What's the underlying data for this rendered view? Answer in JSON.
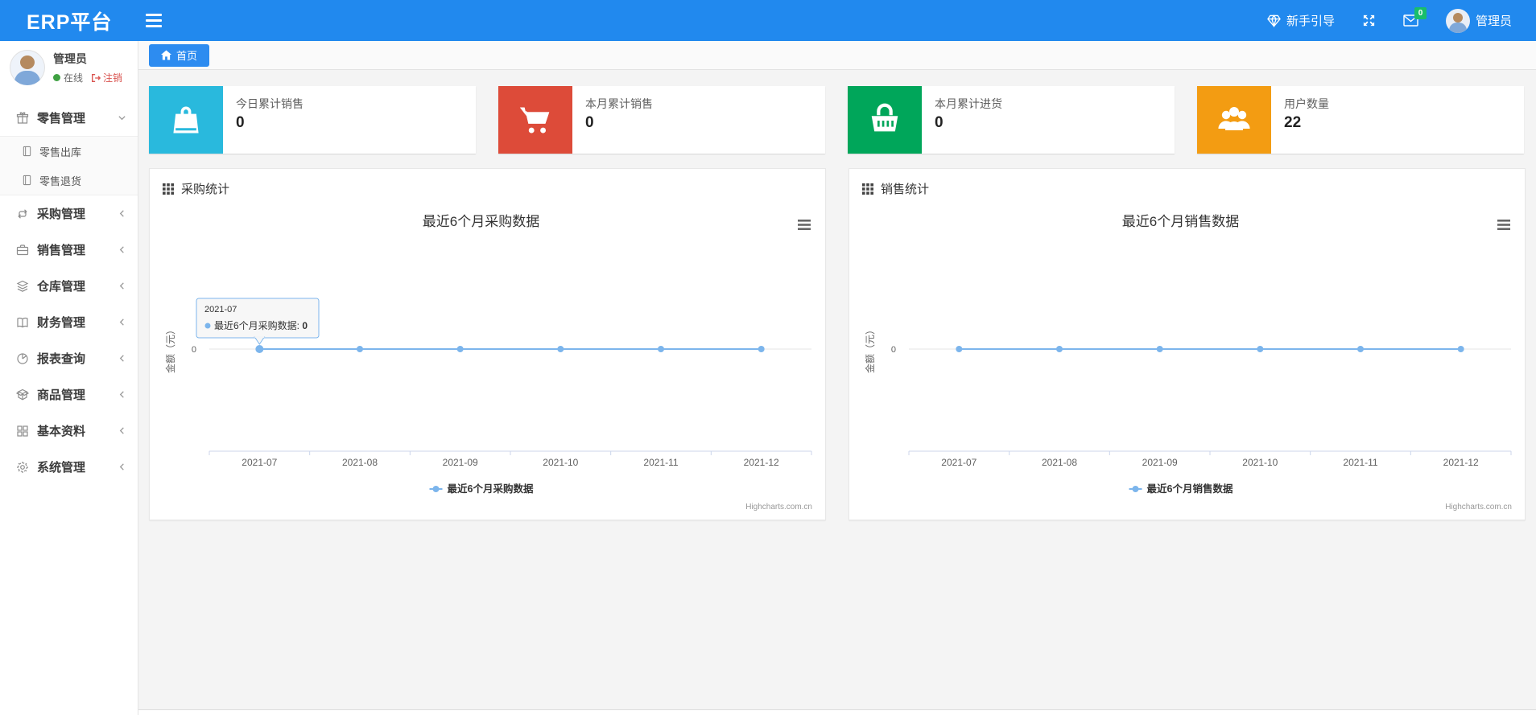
{
  "navbar": {
    "brand": "ERP平台",
    "guide_label": "新手引导",
    "mail_badge": "0",
    "user_label": "管理员"
  },
  "sidebar": {
    "user": {
      "name": "管理员",
      "status": "在线",
      "logout": "注销"
    },
    "items": [
      {
        "label": "零售管理",
        "icon": "gift-icon",
        "state": "expanded"
      },
      {
        "label": "采购管理",
        "icon": "repeat-icon"
      },
      {
        "label": "销售管理",
        "icon": "briefcase-icon"
      },
      {
        "label": "仓库管理",
        "icon": "layers-icon"
      },
      {
        "label": "财务管理",
        "icon": "book-icon"
      },
      {
        "label": "报表查询",
        "icon": "pie-chart-icon"
      },
      {
        "label": "商品管理",
        "icon": "box-icon"
      },
      {
        "label": "基本资料",
        "icon": "grid-icon"
      },
      {
        "label": "系统管理",
        "icon": "gear-icon"
      }
    ],
    "submenu": [
      {
        "label": "零售出库",
        "icon": "file-icon"
      },
      {
        "label": "零售退货",
        "icon": "file-icon"
      }
    ]
  },
  "tabs": {
    "home": "首页"
  },
  "stat_cards": [
    {
      "label": "今日累计销售",
      "value": "0",
      "color": "#29b9dd",
      "icon": "shopping-bag-icon"
    },
    {
      "label": "本月累计销售",
      "value": "0",
      "color": "#dd4b39",
      "icon": "shopping-cart-icon"
    },
    {
      "label": "本月累计进货",
      "value": "0",
      "color": "#00a65a",
      "icon": "shopping-basket-icon"
    },
    {
      "label": "用户数量",
      "value": "22",
      "color": "#f39c12",
      "icon": "users-icon"
    }
  ],
  "panels": [
    {
      "header": "采购统计"
    },
    {
      "header": "销售统计"
    }
  ],
  "chart_data": [
    {
      "type": "line",
      "title": "最近6个月采购数据",
      "categories": [
        "2021-07",
        "2021-08",
        "2021-09",
        "2021-10",
        "2021-11",
        "2021-12"
      ],
      "series": [
        {
          "name": "最近6个月采购数据",
          "values": [
            0,
            0,
            0,
            0,
            0,
            0
          ],
          "color": "#7cb5ec"
        }
      ],
      "ylabel": "金额（元）",
      "yticks": [
        "0"
      ],
      "ylim": [
        0,
        0
      ],
      "grid": true,
      "legend_position": "bottom",
      "credit": "Highcharts.com.cn",
      "tooltip": {
        "header": "2021-07",
        "series_name": "最近6个月采购数据",
        "value": "0",
        "point_index": 0
      }
    },
    {
      "type": "line",
      "title": "最近6个月销售数据",
      "categories": [
        "2021-07",
        "2021-08",
        "2021-09",
        "2021-10",
        "2021-11",
        "2021-12"
      ],
      "series": [
        {
          "name": "最近6个月销售数据",
          "values": [
            0,
            0,
            0,
            0,
            0,
            0
          ],
          "color": "#7cb5ec"
        }
      ],
      "ylabel": "金额（元）",
      "yticks": [
        "0"
      ],
      "ylim": [
        0,
        0
      ],
      "grid": true,
      "legend_position": "bottom",
      "credit": "Highcharts.com.cn"
    }
  ]
}
